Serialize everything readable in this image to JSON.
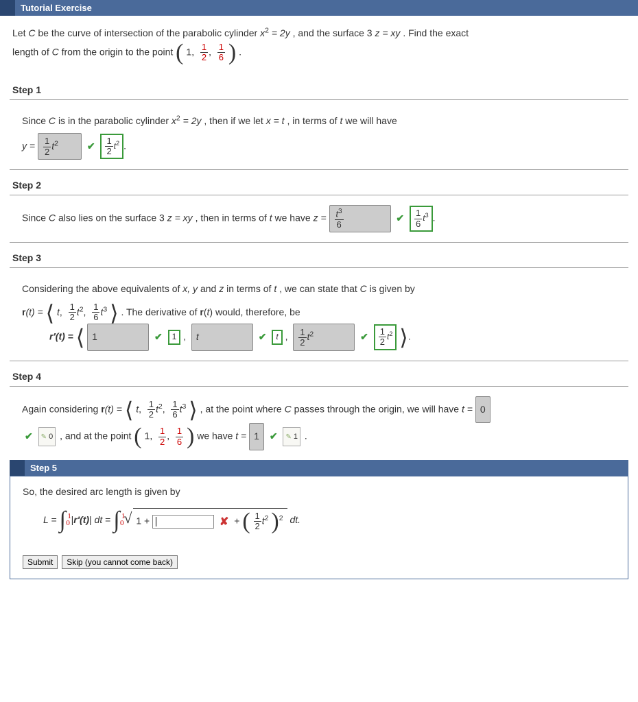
{
  "header": {
    "title": "Tutorial Exercise"
  },
  "problem": {
    "line1_a": "Let ",
    "var_C": "C",
    "line1_b": " be the curve of intersection of the parabolic cylinder ",
    "eq1_lhs": "x",
    "eq1_exp": "2",
    "eq1_rhs": " = 2y",
    "line1_c": ", and the surface 3",
    "eq2_var": "z",
    "eq2_rhs": " = xy",
    "line1_d": ". Find the exact",
    "line2_a": "length of ",
    "line2_b": " from the origin to the point ",
    "point_x": "1",
    "point_y_num": "1",
    "point_y_den": "2",
    "point_z_num": "1",
    "point_z_den": "6",
    "period": "."
  },
  "steps": {
    "s1": {
      "label": "Step 1",
      "text_a": "Since ",
      "text_b": " is in the parabolic cylinder  ",
      "text_c": ",  then if we let ",
      "let": "x = t",
      "text_d": ", in terms of ",
      "tvar": "t",
      "text_e": " we will have",
      "y_eq": "y = ",
      "ans_num": "1",
      "ans_den": "2",
      "ans_tail": "t",
      "ans_exp": "2",
      "hint_num": "1",
      "hint_den": "2",
      "hint_tail": "t",
      "hint_exp": "2"
    },
    "s2": {
      "label": "Step 2",
      "text_a": "Since ",
      "text_b": " also lies on the surface 3",
      "text_c": ", then in terms of ",
      "text_d": " we have  ",
      "z_eq": "z = ",
      "ans_tnum": "t",
      "ans_exp": "3",
      "ans_den": "6",
      "hint_num": "1",
      "hint_den": "6",
      "hint_tail": "t",
      "hint_exp": "3"
    },
    "s3": {
      "label": "Step 3",
      "text_a": "Considering the above equivalents of ",
      "vars": "x, y",
      "text_b": " and ",
      "varz": "z",
      "text_c": " in terms of ",
      "text_d": ", we can state that ",
      "text_e": " is given by",
      "r_label": "r",
      "r_paren": "(t) = ",
      "comp1": "t",
      "comp2_num": "1",
      "comp2_den": "2",
      "comp2_t": "t",
      "comp2_exp": "2",
      "comp3_num": "1",
      "comp3_den": "6",
      "comp3_t": "t",
      "comp3_exp": "3",
      "deriv_text": ".  The derivative of  ",
      "deriv_text2": "  would, therefore, be",
      "rprime": "r'(t) = ",
      "a1": "1",
      "h1": "1",
      "a2": "t",
      "h2": "t",
      "a3_num": "1",
      "a3_den": "2",
      "a3_t": "t",
      "a3_exp": "2",
      "h3_num": "1",
      "h3_den": "2",
      "h3_t": "t",
      "h3_exp": "2"
    },
    "s4": {
      "label": "Step 4",
      "text_a": "Again considering  ",
      "text_b": ",  at the point where ",
      "text_c": " passes through the origin, we will have ",
      "t_eq": "t = ",
      "a0": "0",
      "h0": "0",
      "text_d": ", and at the point ",
      "text_e": " we have ",
      "a1": "1",
      "h1": "1",
      "period": " ."
    },
    "s5": {
      "label": "Step 5",
      "text_a": "So, the desired arc length is given by",
      "L_eq": "L = ",
      "int_top": "1",
      "int_bot": "0",
      "mag_l": "|",
      "mag_r": "|",
      "rprime": "r'(t)",
      "dt": " dt",
      "eq": " = ",
      "one_plus": "1 + ",
      "plus": " + ",
      "sq_num": "1",
      "sq_den": "2",
      "sq_t": "t",
      "sq_exp": "2",
      "outer_exp": "2",
      "dt2": " dt.",
      "submit": "Submit",
      "skip": "Skip (you cannot come back)"
    }
  }
}
